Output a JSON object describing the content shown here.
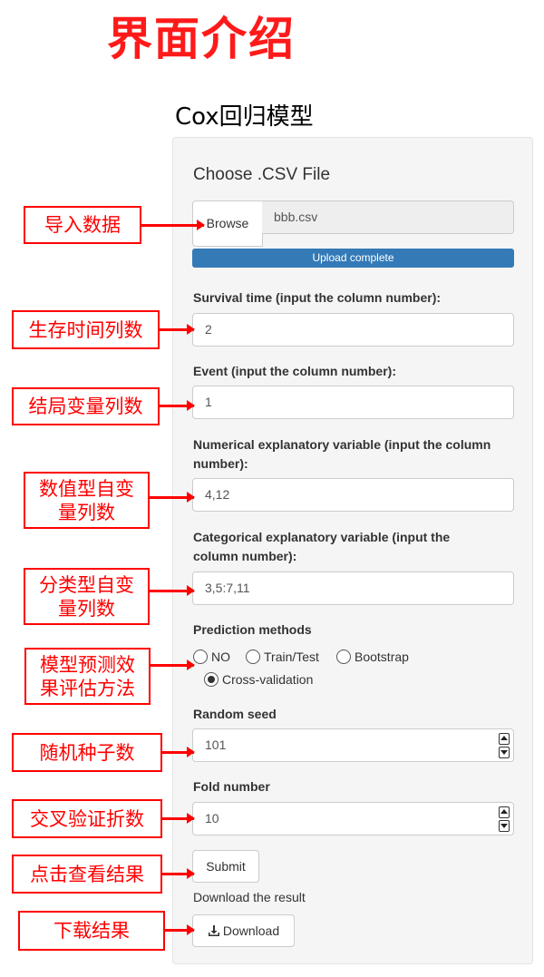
{
  "page_title": "界面介绍",
  "section_title": "Cox回归模型",
  "form": {
    "choose_file_label": "Choose .CSV File",
    "browse_label": "Browse",
    "file_name": "bbb.csv",
    "upload_status": "Upload complete",
    "upload_progress": 1.0,
    "survival_time": {
      "label": "Survival time (input the column number):",
      "value": "2"
    },
    "event": {
      "label": "Event (input the column number):",
      "value": "1"
    },
    "numerical": {
      "label_line1": "Numerical explanatory variable (input the column",
      "label_line2": "number):",
      "value": "4,12"
    },
    "categorical": {
      "label_line1": "Categorical explanatory variable (input the",
      "label_line2": "column number):",
      "value": "3,5:7,11"
    },
    "prediction": {
      "label": "Prediction methods",
      "options": [
        "NO",
        "Train/Test",
        "Bootstrap",
        "Cross-validation"
      ],
      "selected": "Cross-validation"
    },
    "random_seed": {
      "label": "Random seed",
      "value": "101"
    },
    "fold_number": {
      "label": "Fold number",
      "value": "10"
    },
    "submit_label": "Submit",
    "download_note": "Download the result",
    "download_label": "Download"
  },
  "annotations": [
    {
      "text": "导入数据"
    },
    {
      "text": "生存时间列数"
    },
    {
      "text": "结局变量列数"
    },
    {
      "text": "数值型自变量列数"
    },
    {
      "text": "分类型自变量列数"
    },
    {
      "text": "模型预测效果评估方法"
    },
    {
      "text": "随机种子数"
    },
    {
      "text": "交叉验证折数"
    },
    {
      "text": "点击查看结果"
    },
    {
      "text": "下载结果"
    }
  ],
  "colors": {
    "annotation": "#ff0000",
    "title": "#ff1a1a",
    "progress": "#337ab7"
  }
}
